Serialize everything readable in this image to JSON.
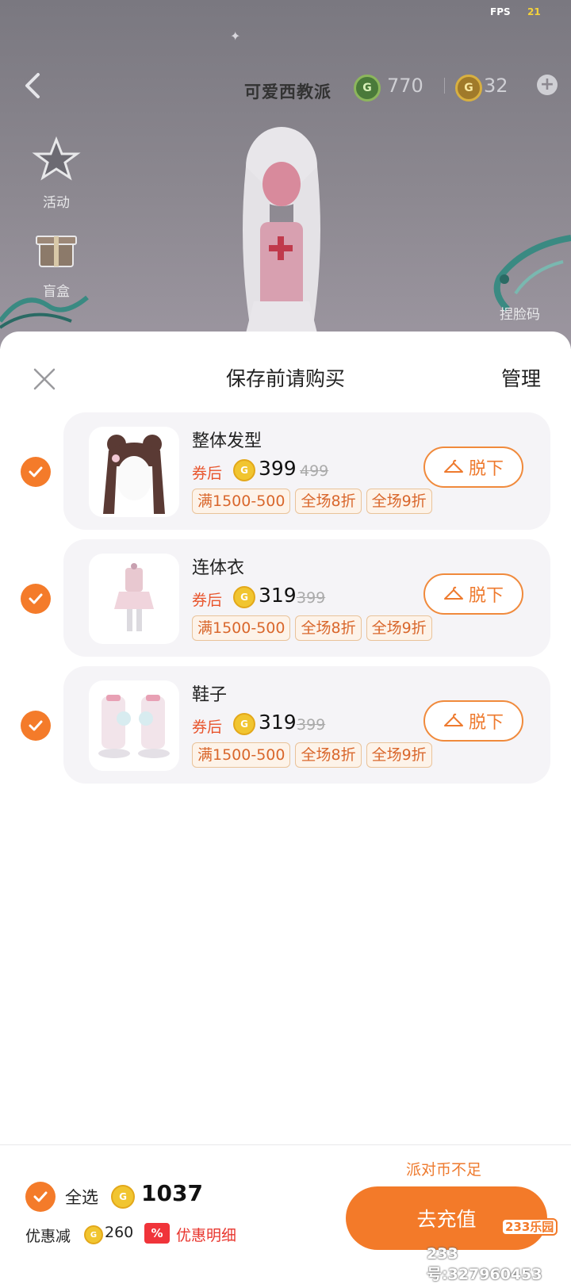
{
  "status": {
    "fps_label": "FPS",
    "fps_value": "21"
  },
  "header": {
    "player_name": "可爱西教派",
    "green_currency": "770",
    "gold_currency": "32"
  },
  "side_menu": {
    "activity": "活动",
    "blind_box": "盲盒"
  },
  "pinch_face": "捏脸码",
  "sheet": {
    "title": "保存前请购买",
    "manage": "管理"
  },
  "items": [
    {
      "name": "整体发型",
      "after_label": "券后",
      "price": "399",
      "orig_price": "499",
      "tags": [
        "满1500-500",
        "全场8折",
        "全场9折"
      ],
      "action": "脱下"
    },
    {
      "name": "连体衣",
      "after_label": "券后",
      "price": "319",
      "orig_price": "399",
      "tags": [
        "满1500-500",
        "全场8折",
        "全场9折"
      ],
      "action": "脱下"
    },
    {
      "name": "鞋子",
      "after_label": "券后",
      "price": "319",
      "orig_price": "399",
      "tags": [
        "满1500-500",
        "全场8折",
        "全场9折"
      ],
      "action": "脱下"
    }
  ],
  "footer": {
    "insufficient": "派对币不足",
    "select_all": "全选",
    "total": "1037",
    "discount_label": "优惠减",
    "discount_value": "260",
    "pct_badge": "%",
    "discount_detail": "优惠明细",
    "recharge": "去充值"
  },
  "watermark": {
    "logo": "233乐园",
    "id": "233号:327960453"
  },
  "colors": {
    "accent": "#f47b2a",
    "price_red": "#e8542c",
    "tag_border": "#e9c39a"
  }
}
